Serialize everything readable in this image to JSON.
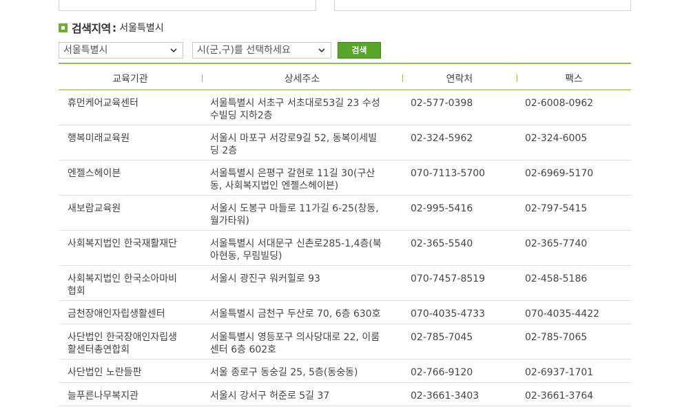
{
  "search": {
    "title": "검색지역",
    "colon": ":",
    "current_region": "서울특별시",
    "city_select": "서울특별시",
    "district_select": "시(군,구)를 선택하세요",
    "button": "검색"
  },
  "table": {
    "headers": [
      "교육기관",
      "상세주소",
      "연락처",
      "팩스"
    ],
    "rows": [
      {
        "name": "휴먼케어교육센터",
        "address": "서울특별시 서초구 서초대로53길 23 수성수빌딩 지하2층",
        "address_lines": [
          "서울특별시 서초구 서초대로53길 23 수성",
          "수빌딩 지하2층"
        ],
        "tel": "02-577-0398",
        "fax": "02-6008-0962"
      },
      {
        "name": "행복미래교육원",
        "address_lines": [
          "서울시 마포구 서강로9길 52, 동복이세빌",
          "딩 2층"
        ],
        "tel": "02-324-5962",
        "fax": "02-324-6005"
      },
      {
        "name": "엔젤스헤이븐",
        "address_lines": [
          "서울특별시 은평구 갈현로 11길 30(구산",
          "동, 사회복지법인 엔젤스헤이븐)"
        ],
        "tel": "070-7113-5700",
        "fax": "02-6969-5170"
      },
      {
        "name": "새보람교육원",
        "address_lines": [
          "서울시 도봉구 마들로 11가길 6-25(창동,",
          "월가타워)"
        ],
        "tel": "02-995-5416",
        "fax": "02-797-5415"
      },
      {
        "name": "사회복지법인 한국재활재단",
        "address_lines": [
          "서울특별시 서대문구 신촌로285-1,4층(북",
          "아현동, 무림빌딩)"
        ],
        "tel": "02-365-5540",
        "fax": "02-365-7740"
      },
      {
        "name_lines": [
          "사회복지법인 한국소아마비",
          "협회"
        ],
        "address_lines": [
          "서울시 광진구 워커힐로 93"
        ],
        "tel": "070-7457-8519",
        "fax": "02-458-5186"
      },
      {
        "name": "금천장애인자립생활센터",
        "address_lines": [
          "서울특별시 금천구 두산로 70, 6층 630호"
        ],
        "tel": "070-4035-4733",
        "fax": "070-4035-4422"
      },
      {
        "name_lines": [
          "사단법인 한국장애인자립생",
          "활센터총연합회"
        ],
        "address_lines": [
          "서울특별시 영등포구 의사당대로 22, 이룸",
          "센터 6층 602호"
        ],
        "tel": "02-785-7045",
        "fax": "02-785-7065"
      },
      {
        "name": "사단법인 노란들판",
        "address_lines": [
          "서울 종로구 동숭길 25, 5층(동숭동)"
        ],
        "tel": "02-766-9120",
        "fax": "02-6937-1701"
      },
      {
        "name": "늘푸른나무복지관",
        "address_lines": [
          "서울시 강서구 허준로 5길 37"
        ],
        "tel": "02-3661-3403",
        "fax": "02-3661-3764"
      }
    ]
  },
  "colors": {
    "accent": "#8cc152",
    "button": "#59a42a",
    "icon": "#6fae2c"
  }
}
